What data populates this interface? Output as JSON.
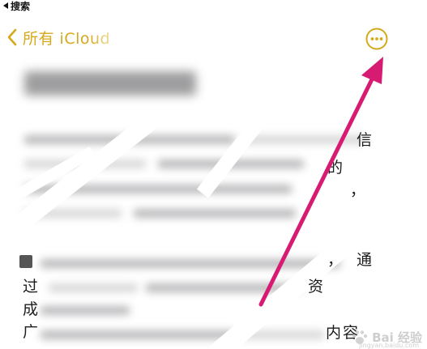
{
  "status_bar": {
    "back_app_label": "搜索"
  },
  "nav": {
    "back_label": "所有 iCloud",
    "more_icon": "ellipsis-circle-icon",
    "accent_color": "#d6a81b"
  },
  "note": {
    "edge_text": [
      "信",
      "的",
      "，",
      "，",
      "通",
      "过",
      "成",
      "广",
      "资",
      "内",
      "容"
    ]
  },
  "annotation": {
    "arrow_color": "#d81b72"
  },
  "watermark": {
    "brand_text": "Bai 经验",
    "sub_text": "jingyan.baidu.com"
  }
}
